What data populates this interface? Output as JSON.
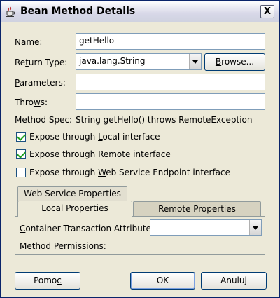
{
  "window": {
    "title": "Bean Method Details",
    "close_label": "X"
  },
  "form": {
    "name": {
      "label_pre": "",
      "label_key": "N",
      "label_post": "ame:",
      "value": "getHello"
    },
    "return_type": {
      "label_pre": "Re",
      "label_key": "t",
      "label_post": "urn Type:",
      "value": "java.lang.String",
      "browse_pre": "",
      "browse_key": "B",
      "browse_post": "rowse..."
    },
    "parameters": {
      "label_pre": "",
      "label_key": "P",
      "label_post": "arameters:",
      "value": ""
    },
    "throws": {
      "label_pre": "Thro",
      "label_key": "w",
      "label_post": "s:",
      "value": ""
    },
    "method_spec": {
      "label": "Method Spec:",
      "value": "String getHello() throws RemoteException"
    }
  },
  "checkboxes": [
    {
      "pre": "Expose through ",
      "key": "L",
      "post": "ocal interface",
      "checked": true
    },
    {
      "pre": "Expose thr",
      "key": "o",
      "post": "ugh Remote interface",
      "checked": true
    },
    {
      "pre": "Expose through ",
      "key": "W",
      "post": "eb Service Endpoint interface",
      "checked": false
    }
  ],
  "tabs": {
    "web_service": "Web Service Properties",
    "local": "Local Properties",
    "remote": "Remote Properties",
    "active": "local"
  },
  "local_panel": {
    "transaction_label_pre": "",
    "transaction_label_key": "C",
    "transaction_label_post": "ontainer Transaction Attribute:",
    "transaction_value": "",
    "permissions_label": "Method Permissions:"
  },
  "buttons": {
    "help_pre": "Pomo",
    "help_key": "c",
    "help_post": "",
    "ok": "OK",
    "cancel": "Anuluj"
  }
}
